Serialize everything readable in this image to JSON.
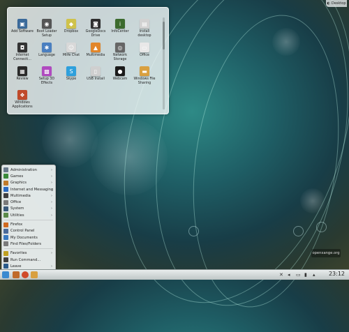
{
  "folder_view": {
    "items": [
      {
        "label": "Add Software",
        "icon": "add-software-icon",
        "color": "#3a6a9a",
        "glyph": "▣"
      },
      {
        "label": "Boot Loader Setup",
        "icon": "boot-loader-icon",
        "color": "#555555",
        "glyph": "◉"
      },
      {
        "label": "Dropbox",
        "icon": "dropbox-icon",
        "color": "#cfc24a",
        "glyph": "◆"
      },
      {
        "label": "GoogleDocs Drive",
        "icon": "google-docs-icon",
        "color": "#2e2e2e",
        "glyph": "◙"
      },
      {
        "label": "InfoCenter",
        "icon": "infocenter-icon",
        "color": "#3c6b2e",
        "glyph": "i"
      },
      {
        "label": "Install desktop",
        "icon": "install-icon",
        "color": "#d2d2d2",
        "glyph": "▤"
      },
      {
        "label": "Internet Connecti...",
        "icon": "internet-connection-icon",
        "color": "#333333",
        "glyph": "◘"
      },
      {
        "label": "Language",
        "icon": "language-icon",
        "color": "#4a7fc0",
        "glyph": "✱"
      },
      {
        "label": "Mlife Chat",
        "icon": "chat-icon",
        "color": "#d8d8d8",
        "glyph": "☺"
      },
      {
        "label": "Multimedia",
        "icon": "multimedia-icon",
        "color": "#e2862a",
        "glyph": "▲"
      },
      {
        "label": "Network Storage",
        "icon": "network-storage-icon",
        "color": "#666666",
        "glyph": "◎"
      },
      {
        "label": "Office",
        "icon": "office-icon",
        "color": "#e8e8e8",
        "glyph": "▭"
      },
      {
        "label": "Review",
        "icon": "review-icon",
        "color": "#2a2a2a",
        "glyph": "▦"
      },
      {
        "label": "Setup 3D Effects",
        "icon": "effects-icon",
        "color": "#b04ac0",
        "glyph": "▩"
      },
      {
        "label": "Skype",
        "icon": "skype-icon",
        "color": "#2ea0dc",
        "glyph": "S"
      },
      {
        "label": "USB Install",
        "icon": "usb-install-icon",
        "color": "#cfcfcf",
        "glyph": "▯"
      },
      {
        "label": "Webcam",
        "icon": "webcam-icon",
        "color": "#1a1a1a",
        "glyph": "●"
      },
      {
        "label": "Windows File Sharing",
        "icon": "file-sharing-icon",
        "color": "#d9a040",
        "glyph": "▬"
      },
      {
        "label": "Windows Applications",
        "icon": "windows-apps-icon",
        "color": "#c04a2a",
        "glyph": "❖"
      }
    ]
  },
  "toolbox": {
    "label": "Desktop"
  },
  "menu": {
    "categories": [
      {
        "label": "Administration",
        "icon": "administration-icon",
        "color": "#6a7a8a"
      },
      {
        "label": "Games",
        "icon": "games-icon",
        "color": "#3a8a3a"
      },
      {
        "label": "Graphics",
        "icon": "graphics-icon",
        "color": "#c07a2a"
      },
      {
        "label": "Internet and Messaging",
        "icon": "internet-icon",
        "color": "#2a6ac0"
      },
      {
        "label": "Multimedia",
        "icon": "multimedia-icon",
        "color": "#404040"
      },
      {
        "label": "Office",
        "icon": "office-icon",
        "color": "#7a7a7a"
      },
      {
        "label": "System",
        "icon": "system-icon",
        "color": "#3a5a7a"
      },
      {
        "label": "Utilities",
        "icon": "utilities-icon",
        "color": "#5a8a4a"
      }
    ],
    "places": [
      {
        "label": "Firefox",
        "icon": "firefox-icon",
        "color": "#d06a20"
      },
      {
        "label": "Control Panel",
        "icon": "control-panel-icon",
        "color": "#4a6a9a"
      },
      {
        "label": "My Documents",
        "icon": "documents-icon",
        "color": "#3a7ac0"
      },
      {
        "label": "Find Files/Folders",
        "icon": "search-icon",
        "color": "#7a7a7a"
      }
    ],
    "bottom": [
      {
        "label": "Favorites",
        "icon": "favorites-icon",
        "color": "#c0a020",
        "arrow": true
      },
      {
        "label": "Run Command...",
        "icon": "run-icon",
        "color": "#404040",
        "arrow": false
      },
      {
        "label": "Leave",
        "icon": "leave-icon",
        "color": "#2a5a8a",
        "arrow": true
      }
    ]
  },
  "panel": {
    "clock": "23:12"
  },
  "watermark": "openxange.org"
}
